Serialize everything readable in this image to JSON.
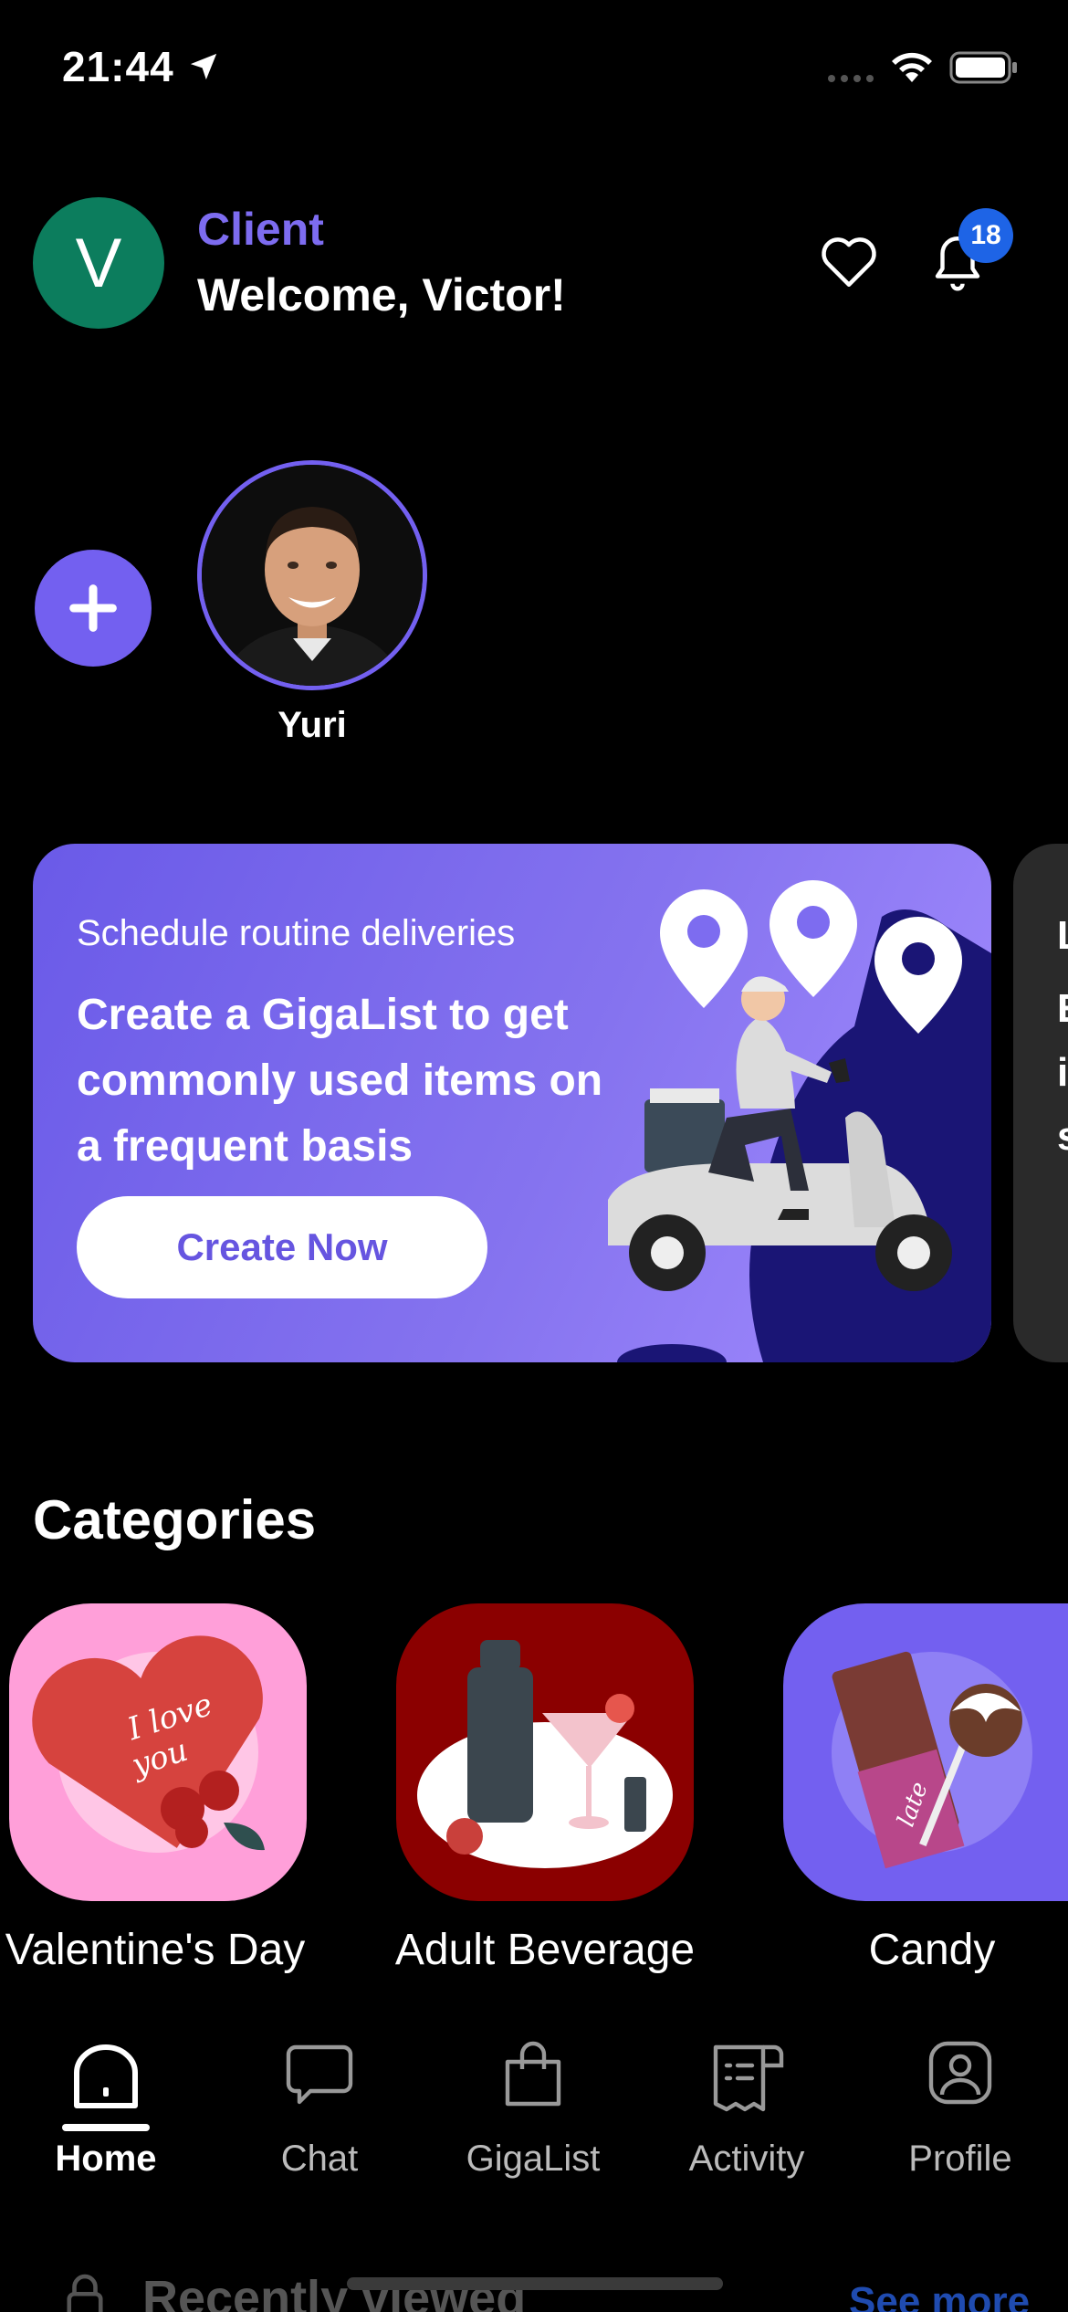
{
  "status_bar": {
    "time": "21:44"
  },
  "header": {
    "avatar_initial": "V",
    "role": "Client",
    "welcome": "Welcome, Victor!",
    "notification_count": "18"
  },
  "stories": {
    "items": [
      {
        "name": "Yuri"
      }
    ]
  },
  "banner": {
    "kicker": "Schedule routine deliveries",
    "title": "Create a GigaList to get commonly used items on a frequent basis",
    "button": "Create Now",
    "next_card_letters": [
      "L",
      "E",
      "i",
      "s"
    ]
  },
  "categories": {
    "title": "Categories",
    "items": [
      {
        "label": "Valentine's Day",
        "color": "#ff9fd9"
      },
      {
        "label": "Adult Beverage",
        "color": "#8b0000"
      },
      {
        "label": "Candy",
        "color": "#7360f0"
      }
    ]
  },
  "recently_viewed": {
    "title": "Recently viewed",
    "more": "See more"
  },
  "tabbar": {
    "items": [
      {
        "label": "Home",
        "icon": "home-icon",
        "active": true
      },
      {
        "label": "Chat",
        "icon": "chat-icon"
      },
      {
        "label": "GigaList",
        "icon": "shopping-bag-icon"
      },
      {
        "label": "Activity",
        "icon": "receipt-icon"
      },
      {
        "label": "Profile",
        "icon": "user-icon"
      }
    ]
  },
  "colors": {
    "accent": "#7360f0",
    "avatar_bg": "#0c7d5d",
    "badge": "#1e64e6"
  }
}
